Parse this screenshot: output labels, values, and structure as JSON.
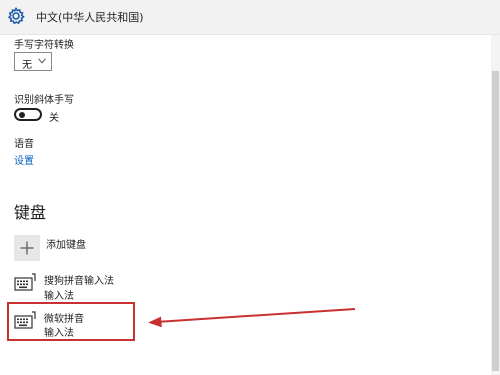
{
  "title_bar": {
    "title": "中文(中华人民共和国)",
    "icon": "gear-icon"
  },
  "settings": {
    "handwriting_conversion": {
      "label": "手写字符转换",
      "selected_value": "无"
    },
    "italic_handwriting": {
      "label": "识别斜体手写",
      "state": "关",
      "on": false
    },
    "speech": {
      "label": "语音",
      "link": "设置"
    }
  },
  "keyboard": {
    "section_title": "键盘",
    "add_label": "添加键盘",
    "items": [
      {
        "name": "搜狗拼音输入法",
        "type": "输入法",
        "icon": "keyboard-icon"
      },
      {
        "name": "微软拼音",
        "type": "输入法",
        "icon": "keyboard-icon",
        "highlighted": true
      }
    ]
  },
  "annotation": {
    "color": "#c8312f"
  }
}
